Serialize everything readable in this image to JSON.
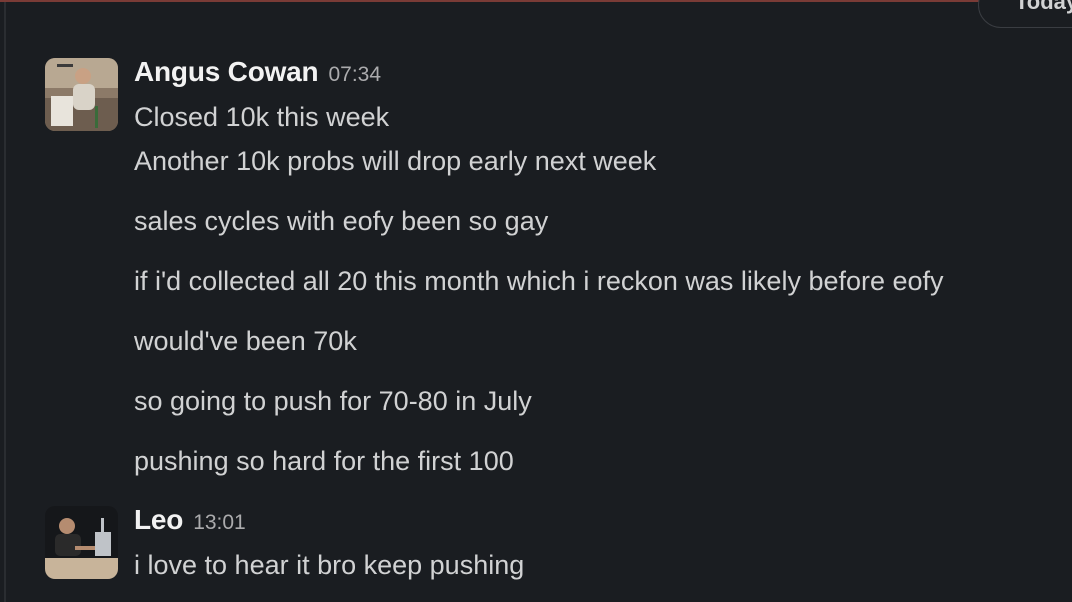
{
  "date_divider": {
    "label": "Today"
  },
  "messages": [
    {
      "sender": "Angus Cowan",
      "time": "07:34",
      "lines": [
        "Closed 10k this week",
        "Another 10k probs will drop early next week",
        "sales cycles with eofy been so gay",
        "if i'd collected all 20 this month which i reckon was likely before eofy",
        "would've been 70k",
        "so going to push for 70-80 in July",
        "pushing so hard for the first 100"
      ]
    },
    {
      "sender": "Leo",
      "time": "13:01",
      "lines": [
        "i love to hear it bro keep pushing"
      ]
    }
  ],
  "colors": {
    "background": "#1a1d21",
    "text": "#d1d2d3",
    "sender": "#f2f2f2",
    "timestamp": "#ababad",
    "top_rule": "#7a3b36"
  }
}
